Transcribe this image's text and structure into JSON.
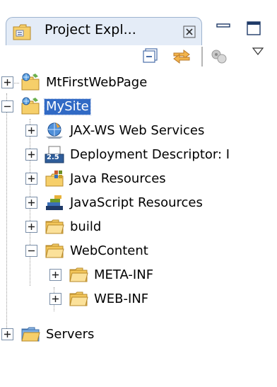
{
  "view": {
    "tab_title": "Project Expl...",
    "tab_close_glyph": "⌧",
    "minimize_icon": "minimize-icon",
    "maximize_icon": "maximize-icon"
  },
  "toolbar": {
    "items": [
      "collapse-all-icon",
      "link-with-editor-icon",
      "synchronize-icon",
      "view-menu-icon"
    ]
  },
  "tree": {
    "items": [
      {
        "label": "MtFirstWebPage",
        "icon": "web-project-icon",
        "expanded": false
      },
      {
        "label": "MySite",
        "icon": "web-project-icon",
        "expanded": true,
        "selected": true
      },
      {
        "label": "JAX-WS Web Services",
        "icon": "web-services-icon",
        "expanded": false
      },
      {
        "label": "Deployment Descriptor: I",
        "icon": "deployment-descriptor-icon",
        "expanded": false
      },
      {
        "label": "Java Resources",
        "icon": "java-resources-icon",
        "expanded": false
      },
      {
        "label": "JavaScript Resources",
        "icon": "javascript-resources-icon",
        "expanded": false
      },
      {
        "label": "build",
        "icon": "folder-icon",
        "expanded": false
      },
      {
        "label": "WebContent",
        "icon": "folder-icon",
        "expanded": true
      },
      {
        "label": "META-INF",
        "icon": "folder-icon",
        "expanded": false
      },
      {
        "label": "WEB-INF",
        "icon": "folder-icon",
        "expanded": false
      },
      {
        "label": "Servers",
        "icon": "servers-folder-icon",
        "expanded": false
      }
    ],
    "deployment_badge": "2.5"
  },
  "colors": {
    "selection": "#316ac5",
    "tab_bg": "#e4ecf7",
    "folder": "#f3c65a"
  }
}
